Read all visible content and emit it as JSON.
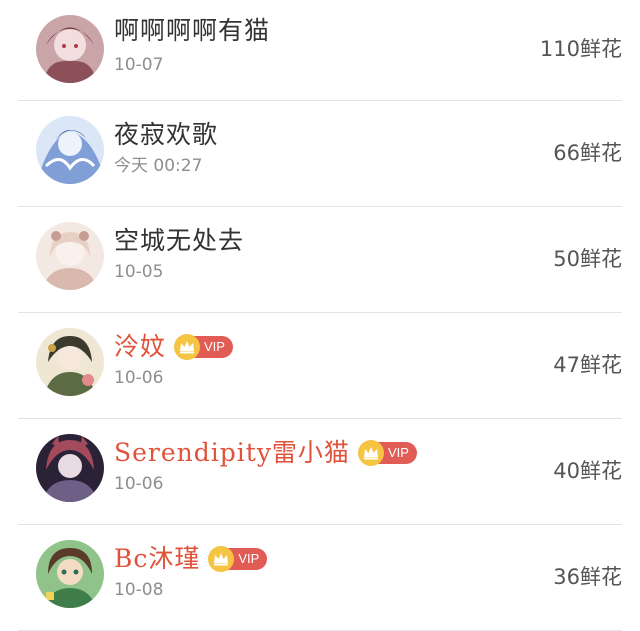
{
  "rows": [
    {
      "name": "啊啊啊啊有猫",
      "time": "10-07",
      "flowers": "110鲜花",
      "vip": false,
      "avatar": {
        "bg": "#c9a5a8",
        "fg": "#7a3b46"
      }
    },
    {
      "name": "夜寂欢歌",
      "time": "今天 00:27",
      "flowers": "66鲜花",
      "vip": false,
      "avatar": {
        "bg": "#bcd0ef",
        "fg": "#3e5f9e"
      }
    },
    {
      "name": "空城无处去",
      "time": "10-05",
      "flowers": "50鲜花",
      "vip": false,
      "avatar": {
        "bg": "#f0e2d9",
        "fg": "#c79d93"
      }
    },
    {
      "name": "泠妏",
      "time": "10-06",
      "flowers": "47鲜花",
      "vip": true,
      "vip_label": "VIP",
      "avatar": {
        "bg": "#e6dcc6",
        "fg": "#5b6b43"
      }
    },
    {
      "name": "Serendipity雷小猫",
      "time": "10-06",
      "flowers": "40鲜花",
      "vip": true,
      "vip_label": "VIP",
      "avatar": {
        "bg": "#2a2236",
        "fg": "#a34a5c"
      }
    },
    {
      "name": "Bc沐瑾",
      "time": "10-08",
      "flowers": "36鲜花",
      "vip": true,
      "vip_label": "VIP",
      "avatar": {
        "bg": "#8fc38a",
        "fg": "#5a3b2a"
      }
    }
  ],
  "colors": {
    "vip_name": "#e0523a",
    "vip_badge": "#e05c55",
    "crown": "#f6c443",
    "name": "#333333",
    "time": "#8e8e8e",
    "divider": "#e3e3e3"
  }
}
